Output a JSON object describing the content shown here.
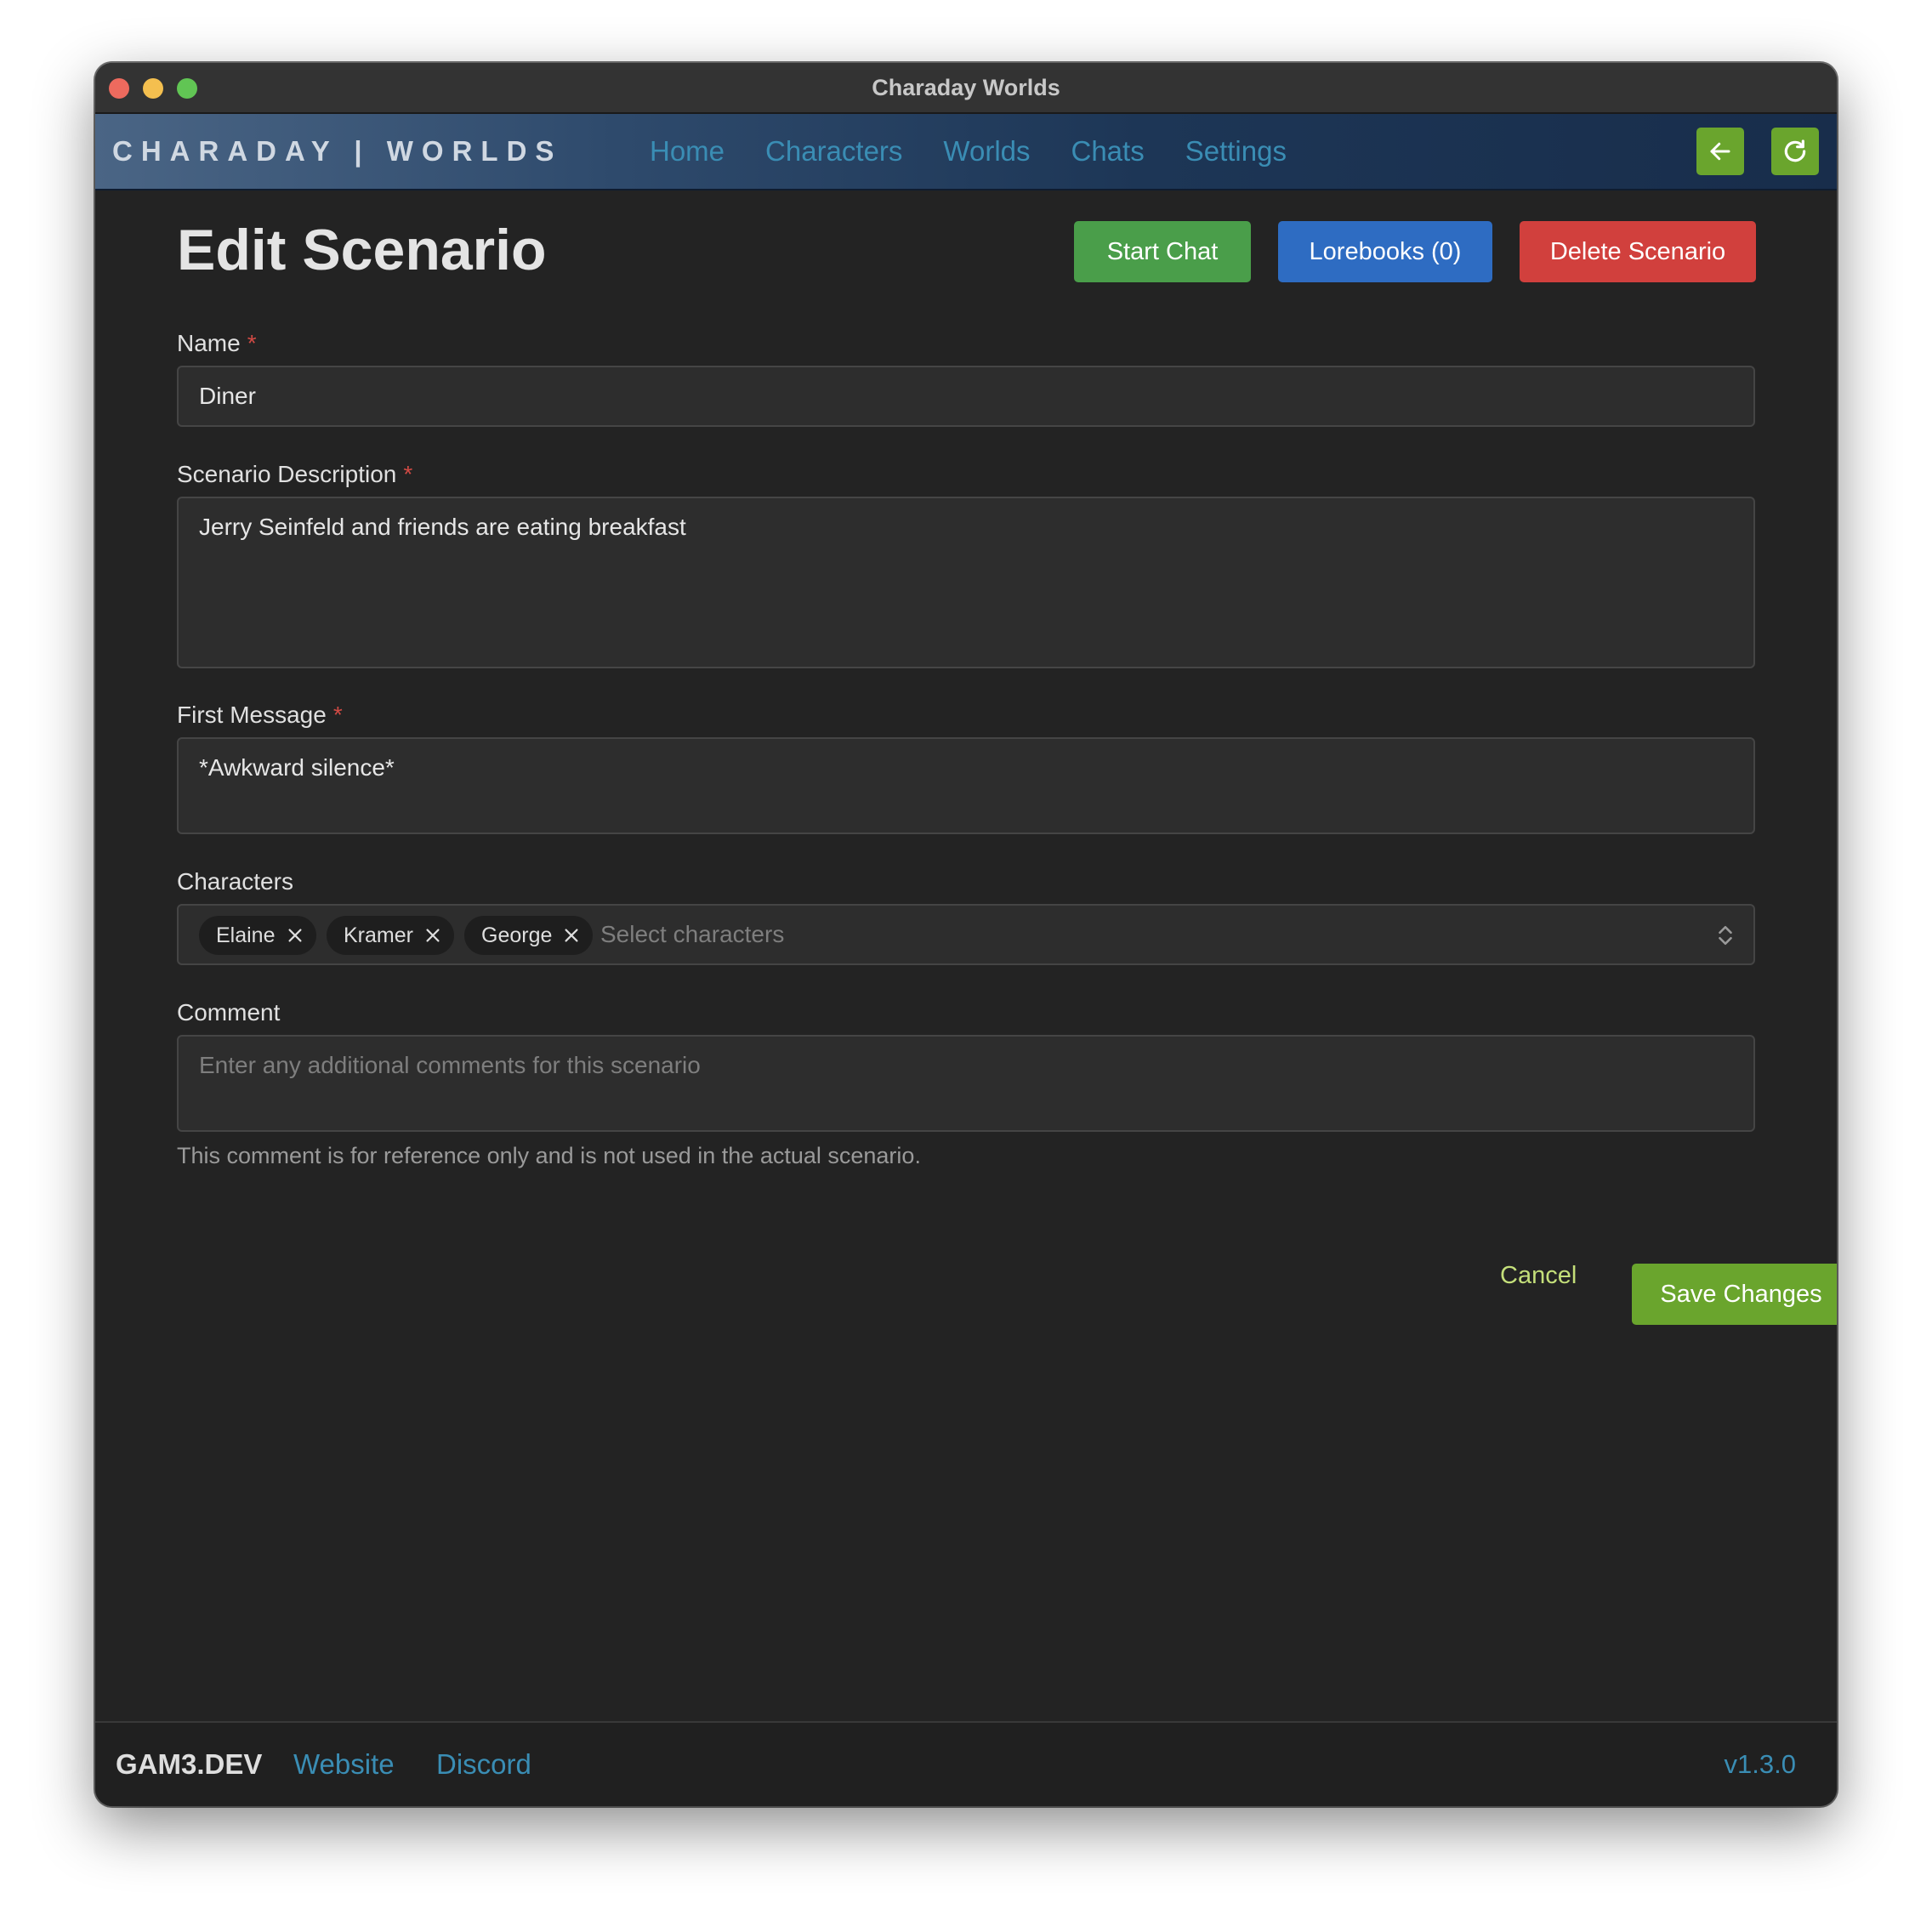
{
  "window": {
    "title": "Charaday Worlds"
  },
  "navbar": {
    "brand": "CHARADAY | WORLDS",
    "links": [
      "Home",
      "Characters",
      "Worlds",
      "Chats",
      "Settings"
    ],
    "back_icon": "arrow-left-icon",
    "refresh_icon": "refresh-icon",
    "accent_color": "#6aa52d"
  },
  "page": {
    "title": "Edit Scenario",
    "actions": {
      "start_chat": "Start Chat",
      "lorebooks": "Lorebooks (0)",
      "delete": "Delete Scenario"
    }
  },
  "form": {
    "name": {
      "label": "Name",
      "required_mark": "*",
      "value": "Diner"
    },
    "description": {
      "label": "Scenario Description",
      "required_mark": "*",
      "value": "Jerry Seinfeld and friends are eating breakfast"
    },
    "first_message": {
      "label": "First Message",
      "required_mark": "*",
      "value": "*Awkward silence*"
    },
    "characters": {
      "label": "Characters",
      "selected": [
        "Elaine",
        "Kramer",
        "George"
      ],
      "placeholder": "Select characters"
    },
    "comment": {
      "label": "Comment",
      "placeholder": "Enter any additional comments for this scenario",
      "hint": "This comment is for reference only and is not used in the actual scenario."
    },
    "cancel": "Cancel",
    "save": "Save Changes"
  },
  "footer": {
    "brand": "GAM3.DEV",
    "links": [
      "Website",
      "Discord"
    ],
    "version": "v1.3.0"
  }
}
